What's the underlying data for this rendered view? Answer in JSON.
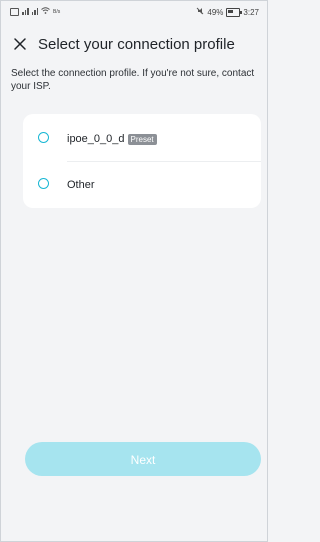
{
  "status_bar": {
    "left": "¹⁹²",
    "speed": "B/s",
    "battery": "49%",
    "time": "3:27"
  },
  "header": {
    "title": "Select your connection profile"
  },
  "instructions": "Select the connection profile. If you're not sure, contact your ISP.",
  "options": [
    {
      "label": "ipoe_0_0_d",
      "badge": "Preset"
    },
    {
      "label": "Other"
    }
  ],
  "next_label": "Next"
}
